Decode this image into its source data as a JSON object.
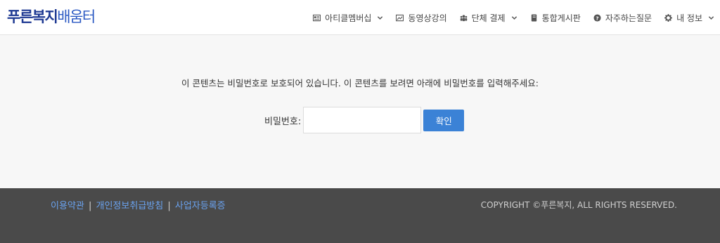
{
  "logo": {
    "bold": "푸른복지",
    "light": "배움터"
  },
  "nav": {
    "items": [
      {
        "label": "아티클멤버십",
        "icon": "newspaper-icon",
        "dropdown": true
      },
      {
        "label": "동영상강의",
        "icon": "video-icon",
        "dropdown": false
      },
      {
        "label": "단체 결제",
        "icon": "group-icon",
        "dropdown": true
      },
      {
        "label": "통합게시판",
        "icon": "book-icon",
        "dropdown": false
      },
      {
        "label": "자주하는질문",
        "icon": "question-icon",
        "dropdown": false
      },
      {
        "label": "내 정보",
        "icon": "gear-icon",
        "dropdown": true
      }
    ]
  },
  "main": {
    "notice": "이 콘텐츠는 비밀번호로 보호되어 있습니다. 이 콘텐츠를 보려면 아래에 비밀번호를 입력해주세요:",
    "password_label": "비밀번호:",
    "password_value": "",
    "confirm_label": "확인"
  },
  "footer": {
    "links": [
      "이용약관",
      "개인정보취급방침",
      "사업자등록증"
    ],
    "separator": "|",
    "copyright": "COPYRIGHT ©푸른복지, ALL RIGHTS RESERVED."
  },
  "colors": {
    "brand_dark": "#1f3a93",
    "brand_light": "#2b59c3",
    "button": "#3b82d6",
    "footer_bg": "#4a4a4a",
    "footer_link": "#6aa3f0"
  }
}
